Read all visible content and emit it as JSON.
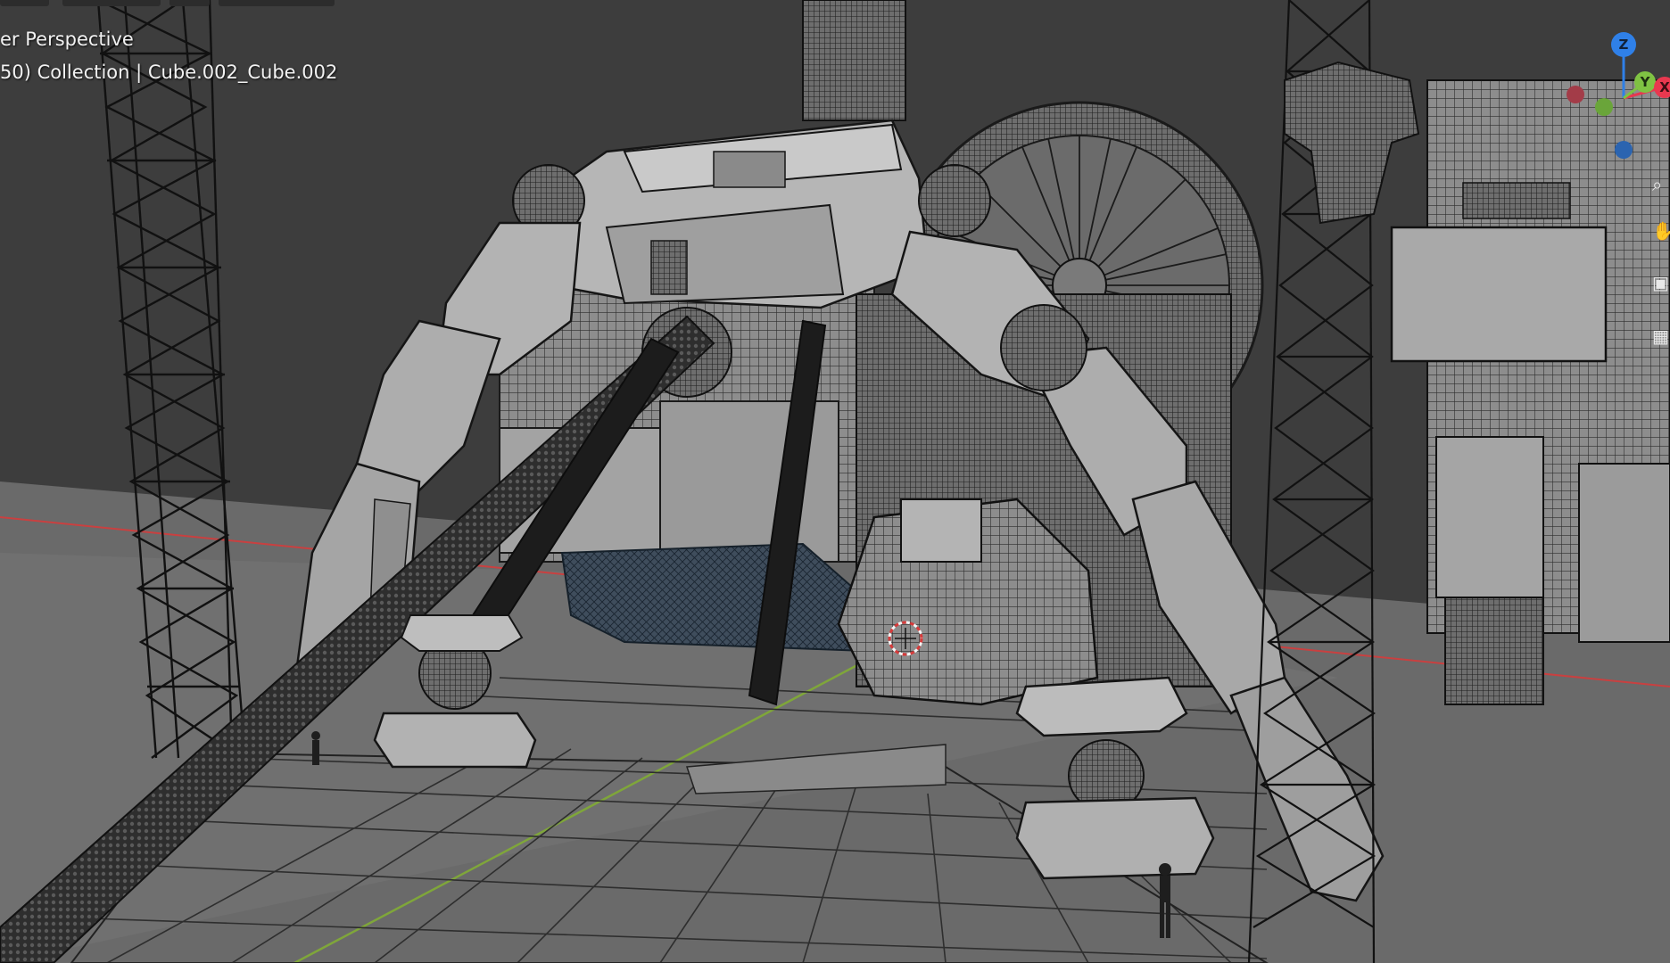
{
  "viewport": {
    "view_name": "er Perspective",
    "collection_info": "50) Collection | Cube.002_Cube.002"
  },
  "navigation_gizmo": {
    "axes": [
      {
        "label": "Z",
        "color": "#2f80e8"
      },
      {
        "label": "Y",
        "color": "#7fc243"
      },
      {
        "label": "X",
        "color": "#e8384f"
      }
    ]
  },
  "side_tools": [
    {
      "icon": "zoom-icon"
    },
    {
      "icon": "hand-pan-icon"
    },
    {
      "icon": "camera-icon"
    },
    {
      "icon": "grid-ortho-icon"
    }
  ],
  "colors": {
    "background": "#3d3d3d",
    "floor": "#6a6a6a",
    "grid_line": "#2a2a2a",
    "mesh_light": "#a8a8a8",
    "mesh_mid": "#7c7c7c",
    "mesh_dark": "#262626",
    "x_axis": "#c94040",
    "y_axis": "#7fa63a",
    "cursor_red": "#d63b3b"
  }
}
